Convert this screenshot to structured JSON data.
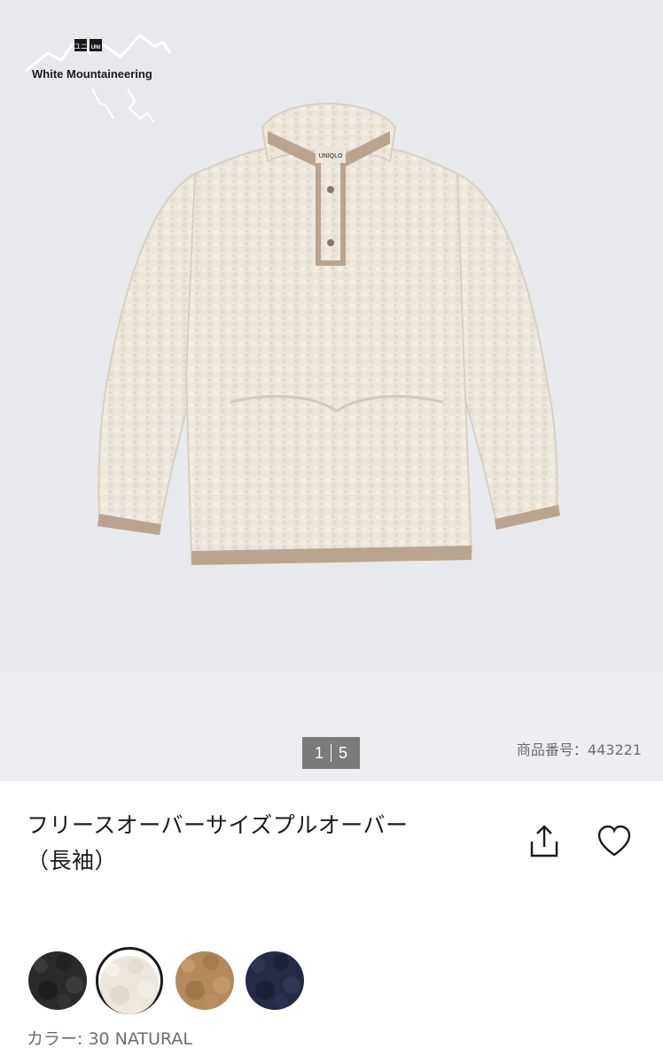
{
  "brand": {
    "uniqlo_logo": "UNIQLO",
    "collab_name": "White Mountaineering"
  },
  "gallery": {
    "current": "1",
    "total": "5",
    "product_code": "商品番号：443221"
  },
  "product": {
    "title_line1": "フリースオーバーサイズプルオーバー",
    "title_line2": "（長袖）"
  },
  "actions": {
    "share_icon": "share-icon",
    "favorite_icon": "heart-icon"
  },
  "colors": {
    "label": "カラー: 30 NATURAL",
    "swatches": [
      {
        "name": "black",
        "hex": "#2a2a2a"
      },
      {
        "name": "natural",
        "hex": "#ece6dc",
        "selected": true
      },
      {
        "name": "brown",
        "hex": "#b48a5c"
      },
      {
        "name": "navy",
        "hex": "#252b45"
      }
    ]
  },
  "theme": {
    "hero_bg": "#e8e9ec",
    "pager_bg": "#7b7b7b",
    "text": "#1b1b1b",
    "muted": "#6d6d6d"
  }
}
